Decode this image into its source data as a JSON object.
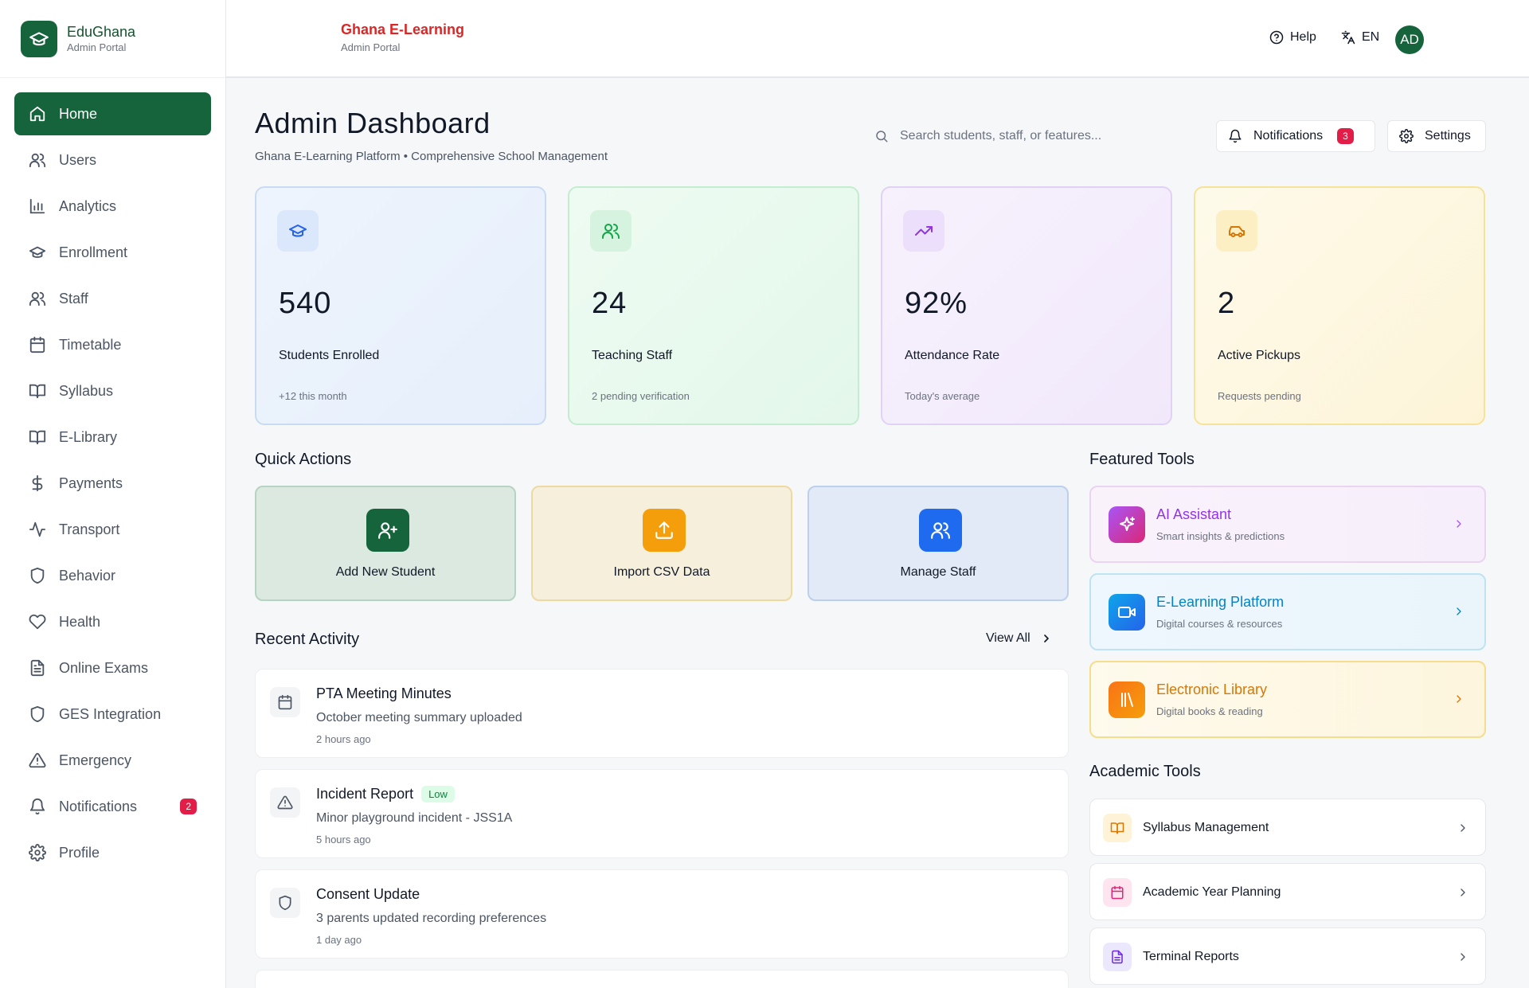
{
  "brand": {
    "name": "EduGhana",
    "subtitle": "Admin Portal"
  },
  "sidebar": {
    "items": [
      {
        "label": "Home",
        "icon": "home-icon",
        "active": true
      },
      {
        "label": "Users",
        "icon": "users-icon"
      },
      {
        "label": "Analytics",
        "icon": "bar-chart-icon"
      },
      {
        "label": "Enrollment",
        "icon": "graduation-cap-icon"
      },
      {
        "label": "Staff",
        "icon": "users-icon"
      },
      {
        "label": "Timetable",
        "icon": "calendar-icon"
      },
      {
        "label": "Syllabus",
        "icon": "book-open-icon"
      },
      {
        "label": "E-Library",
        "icon": "book-open-icon"
      },
      {
        "label": "Payments",
        "icon": "dollar-icon"
      },
      {
        "label": "Transport",
        "icon": "activity-icon"
      },
      {
        "label": "Behavior",
        "icon": "shield-icon"
      },
      {
        "label": "Health",
        "icon": "heart-icon"
      },
      {
        "label": "Online Exams",
        "icon": "file-text-icon"
      },
      {
        "label": "GES Integration",
        "icon": "shield-icon"
      },
      {
        "label": "Emergency",
        "icon": "alert-triangle-icon"
      },
      {
        "label": "Notifications",
        "icon": "bell-icon",
        "badge": "2"
      },
      {
        "label": "Profile",
        "icon": "gear-icon"
      }
    ]
  },
  "header": {
    "title": "Ghana E-Learning",
    "subtitle": "Admin Portal",
    "help_label": "Help",
    "language": "EN",
    "avatar_initials": "AD"
  },
  "main": {
    "title": "Admin Dashboard",
    "subtitle": "Ghana E-Learning Platform • Comprehensive School Management",
    "search_placeholder": "Search students, staff, or features...",
    "notifications_label": "Notifications",
    "notifications_count": "3",
    "settings_label": "Settings"
  },
  "stats": [
    {
      "value": "540",
      "label": "Students Enrolled",
      "note": "+12 this month",
      "icon": "graduation-cap-icon"
    },
    {
      "value": "24",
      "label": "Teaching Staff",
      "note": "2 pending verification",
      "icon": "users-icon"
    },
    {
      "value": "92%",
      "label": "Attendance Rate",
      "note": "Today's average",
      "icon": "trending-up-icon"
    },
    {
      "value": "2",
      "label": "Active Pickups",
      "note": "Requests pending",
      "icon": "car-icon"
    }
  ],
  "quick_actions": {
    "heading": "Quick Actions",
    "items": [
      {
        "label": "Add New Student",
        "icon": "user-plus-icon"
      },
      {
        "label": "Import CSV Data",
        "icon": "upload-icon"
      },
      {
        "label": "Manage Staff",
        "icon": "users-icon"
      }
    ]
  },
  "recent_activity": {
    "heading": "Recent Activity",
    "view_all": "View All",
    "items": [
      {
        "title": "PTA Meeting Minutes",
        "description": "October meeting summary uploaded",
        "time": "2 hours ago",
        "icon": "calendar-icon"
      },
      {
        "title": "Incident Report",
        "badge": "Low",
        "description": "Minor playground incident - JSS1A",
        "time": "5 hours ago",
        "icon": "alert-triangle-icon"
      },
      {
        "title": "Consent Update",
        "description": "3 parents updated recording preferences",
        "time": "1 day ago",
        "icon": "shield-icon"
      }
    ]
  },
  "featured_tools": {
    "heading": "Featured Tools",
    "items": [
      {
        "title": "AI Assistant",
        "subtitle": "Smart insights & predictions",
        "icon": "sparkles-icon"
      },
      {
        "title": "E-Learning Platform",
        "subtitle": "Digital courses & resources",
        "icon": "video-icon"
      },
      {
        "title": "Electronic Library",
        "subtitle": "Digital books & reading",
        "icon": "library-icon"
      }
    ]
  },
  "academic_tools": {
    "heading": "Academic Tools",
    "items": [
      {
        "label": "Syllabus Management",
        "icon": "book-open-icon"
      },
      {
        "label": "Academic Year Planning",
        "icon": "calendar-icon"
      },
      {
        "label": "Terminal Reports",
        "icon": "file-text-icon"
      }
    ]
  },
  "colors": {
    "brand_green": "#16643b",
    "header_red": "#dc2626",
    "badge_red": "#e11d48"
  }
}
